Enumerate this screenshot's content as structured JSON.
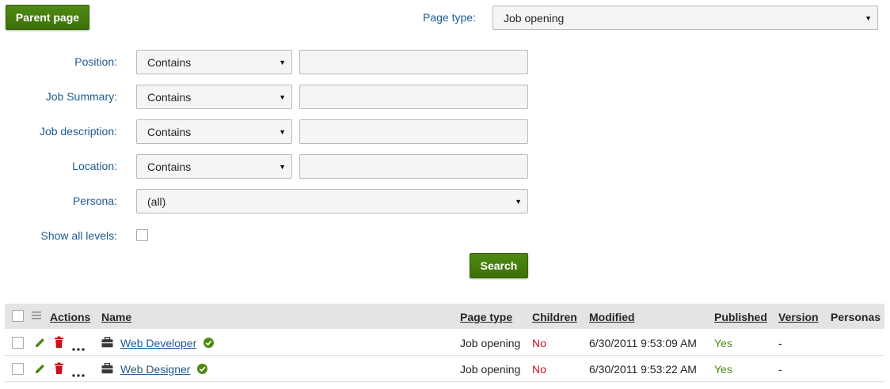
{
  "toolbar": {
    "parent_page_label": "Parent page"
  },
  "page_type_filter": {
    "label": "Page type:",
    "selected": "Job opening"
  },
  "filters": [
    {
      "label": "Position:",
      "operator": "Contains",
      "value": ""
    },
    {
      "label": "Job Summary:",
      "operator": "Contains",
      "value": ""
    },
    {
      "label": "Job description:",
      "operator": "Contains",
      "value": ""
    },
    {
      "label": "Location:",
      "operator": "Contains",
      "value": ""
    }
  ],
  "persona": {
    "label": "Persona:",
    "selected": "(all)"
  },
  "show_all_levels": {
    "label": "Show all levels:",
    "checked": false
  },
  "search_label": "Search",
  "grid": {
    "columns": {
      "actions": "Actions",
      "name": "Name",
      "page_type": "Page type",
      "children": "Children",
      "modified": "Modified",
      "published": "Published",
      "version": "Version",
      "personas": "Personas"
    },
    "rows": [
      {
        "name": "Web Developer",
        "page_type": "Job opening",
        "children": "No",
        "modified": "6/30/2011 9:53:09 AM",
        "published": "Yes",
        "version": "-"
      },
      {
        "name": "Web Designer",
        "page_type": "Job opening",
        "children": "No",
        "modified": "6/30/2011 9:53:22 AM",
        "published": "Yes",
        "version": "-"
      }
    ]
  },
  "colors": {
    "accent_green": "#3f730c",
    "label_blue": "#1e5a92",
    "no_red": "#c9111c",
    "yes_green": "#4a8a12"
  },
  "icons": [
    "menu-icon",
    "edit-icon",
    "delete-icon",
    "more-icon",
    "page-type-icon",
    "published-check-icon",
    "caret-down-icon"
  ]
}
